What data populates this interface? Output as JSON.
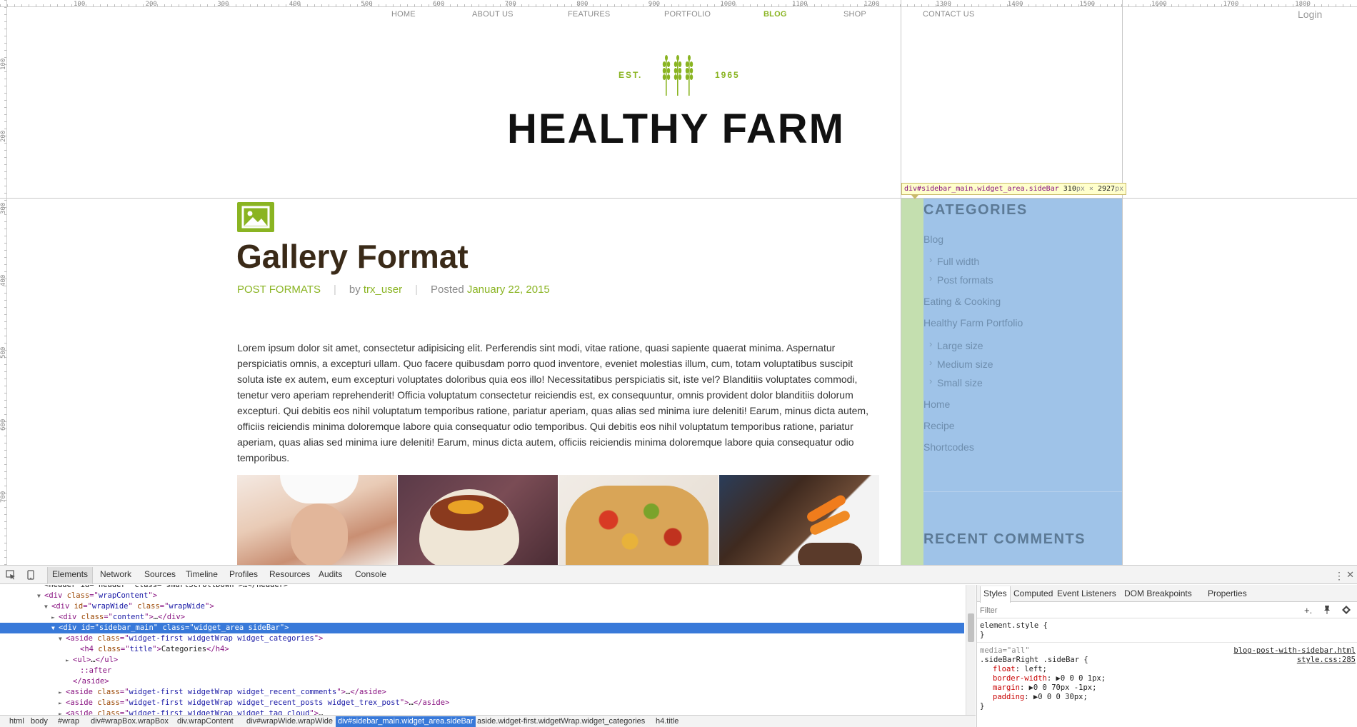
{
  "ruler": {
    "top_ticks": [
      "100",
      "200",
      "300",
      "400",
      "500",
      "600",
      "700",
      "800",
      "900",
      "1000",
      "1100",
      "1200",
      "1300",
      "1400",
      "1500",
      "1600",
      "1700",
      "1800"
    ],
    "left_ticks": [
      "100",
      "200",
      "300",
      "400",
      "500",
      "600",
      "700"
    ]
  },
  "nav": {
    "items": [
      "HOME",
      "ABOUT US",
      "FEATURES",
      "PORTFOLIO",
      "BLOG",
      "SHOP",
      "CONTACT US"
    ],
    "active": "BLOG",
    "login": "Login"
  },
  "logo": {
    "est": "EST.",
    "year": "1965",
    "site_title": "HEALTHY FARM"
  },
  "post": {
    "title": "Gallery Format",
    "category": "POST FORMATS",
    "by_label": "by",
    "author": "trx_user",
    "posted_label": "Posted",
    "date": "January 22, 2015",
    "body": "Lorem ipsum dolor sit amet, consectetur adipisicing elit. Perferendis sint modi, vitae ratione, quasi sapiente quaerat minima. Aspernatur perspiciatis omnis, a excepturi ullam. Quo facere quibusdam porro quod inventore, eveniet molestias illum, cum, totam voluptatibus suscipit soluta iste ex autem, eum excepturi voluptates doloribus quia eos illo! Necessitatibus perspiciatis sit, iste vel? Blanditiis voluptates commodi, tenetur vero aperiam reprehenderit! Officia voluptatum consectetur reiciendis est, ex consequuntur, omnis provident dolor blanditiis dolorum excepturi. Qui debitis eos nihil voluptatum temporibus ratione, pariatur aperiam, quas alias sed minima iure deleniti! Earum, minus dicta autem, officiis reiciendis minima doloremque labore quia consequatur odio temporibus. Qui debitis eos nihil voluptatum temporibus ratione, pariatur aperiam, quas alias sed minima iure deleniti! Earum, minus dicta autem, officiis reiciendis minima doloremque labore quia consequatur odio temporibus."
  },
  "inspector_tooltip": {
    "selector": "div#sidebar_main.widget_area.sideBar",
    "width": "310",
    "height": "2927",
    "unit": "px",
    "times": "×"
  },
  "sidebar": {
    "categories_title": "CATEGORIES",
    "categories": [
      {
        "label": "Blog",
        "sub": false
      },
      {
        "label": "Full width",
        "sub": true
      },
      {
        "label": "Post formats",
        "sub": true
      },
      {
        "label": "Eating & Cooking",
        "sub": false
      },
      {
        "label": "Healthy Farm Portfolio",
        "sub": false
      },
      {
        "label": "Large size",
        "sub": true
      },
      {
        "label": "Medium size",
        "sub": true
      },
      {
        "label": "Small size",
        "sub": true
      },
      {
        "label": "Home",
        "sub": false
      },
      {
        "label": "Recipe",
        "sub": false
      },
      {
        "label": "Shortcodes",
        "sub": false
      }
    ],
    "recent_comments_title": "RECENT COMMENTS"
  },
  "devtools": {
    "tabs": [
      "Elements",
      "Network",
      "Sources",
      "Timeline",
      "Profiles",
      "Resources",
      "Audits",
      "Console"
    ],
    "active_tab": "Elements",
    "tree": [
      {
        "indent": 5,
        "tri": "",
        "html": [
          [
            "t-txt",
            "<header id=\"header\" class=\"smartScrollDown\">…</header>"
          ]
        ]
      },
      {
        "indent": 5,
        "tri": "▼",
        "html": [
          [
            "t-tag",
            "<div "
          ],
          [
            "t-attr",
            "class"
          ],
          [
            "t-tag",
            "=\""
          ],
          [
            "t-val",
            "wrapContent"
          ],
          [
            "t-tag",
            "\">"
          ]
        ]
      },
      {
        "indent": 6,
        "tri": "▼",
        "html": [
          [
            "t-tag",
            "<div "
          ],
          [
            "t-attr",
            "id"
          ],
          [
            "t-tag",
            "=\""
          ],
          [
            "t-val",
            "wrapWide"
          ],
          [
            "t-tag",
            "\" "
          ],
          [
            "t-attr",
            "class"
          ],
          [
            "t-tag",
            "=\""
          ],
          [
            "t-val",
            "wrapWide"
          ],
          [
            "t-tag",
            "\">"
          ]
        ]
      },
      {
        "indent": 7,
        "tri": "►",
        "html": [
          [
            "t-tag",
            "<div "
          ],
          [
            "t-attr",
            "class"
          ],
          [
            "t-tag",
            "=\""
          ],
          [
            "t-val",
            "content"
          ],
          [
            "t-tag",
            "\">"
          ],
          [
            "t-txt",
            "…"
          ],
          [
            "t-tag",
            "</div>"
          ]
        ]
      },
      {
        "indent": 7,
        "tri": "▼",
        "selected": true,
        "html": [
          [
            "t-tag",
            "<div "
          ],
          [
            "t-attr",
            "id"
          ],
          [
            "t-tag",
            "=\""
          ],
          [
            "t-val",
            "sidebar_main"
          ],
          [
            "t-tag",
            "\" "
          ],
          [
            "t-attr",
            "class"
          ],
          [
            "t-tag",
            "=\""
          ],
          [
            "t-val",
            "widget_area sideBar"
          ],
          [
            "t-tag",
            "\">"
          ]
        ]
      },
      {
        "indent": 8,
        "tri": "▼",
        "html": [
          [
            "t-tag",
            "<aside "
          ],
          [
            "t-attr",
            "class"
          ],
          [
            "t-tag",
            "=\""
          ],
          [
            "t-val",
            "widget-first widgetWrap widget_categories"
          ],
          [
            "t-tag",
            "\">"
          ]
        ]
      },
      {
        "indent": 10,
        "tri": "",
        "html": [
          [
            "t-tag",
            "<h4 "
          ],
          [
            "t-attr",
            "class"
          ],
          [
            "t-tag",
            "=\""
          ],
          [
            "t-val",
            "title"
          ],
          [
            "t-tag",
            "\">"
          ],
          [
            "t-txt",
            "Categories"
          ],
          [
            "t-tag",
            "</h4>"
          ]
        ]
      },
      {
        "indent": 9,
        "tri": "►",
        "html": [
          [
            "t-tag",
            "<ul>"
          ],
          [
            "t-txt",
            "…"
          ],
          [
            "t-tag",
            "</ul>"
          ]
        ]
      },
      {
        "indent": 10,
        "tri": "",
        "html": [
          [
            "t-tag",
            "::after"
          ]
        ]
      },
      {
        "indent": 9,
        "tri": "",
        "html": [
          [
            "t-tag",
            "</aside>"
          ]
        ]
      },
      {
        "indent": 8,
        "tri": "►",
        "html": [
          [
            "t-tag",
            "<aside "
          ],
          [
            "t-attr",
            "class"
          ],
          [
            "t-tag",
            "=\""
          ],
          [
            "t-val",
            "widget-first widgetWrap widget_recent_comments"
          ],
          [
            "t-tag",
            "\">"
          ],
          [
            "t-txt",
            "…"
          ],
          [
            "t-tag",
            "</aside>"
          ]
        ]
      },
      {
        "indent": 8,
        "tri": "►",
        "html": [
          [
            "t-tag",
            "<aside "
          ],
          [
            "t-attr",
            "class"
          ],
          [
            "t-tag",
            "=\""
          ],
          [
            "t-val",
            "widget-first widgetWrap widget_recent_posts widget_trex_post"
          ],
          [
            "t-tag",
            "\">"
          ],
          [
            "t-txt",
            "…"
          ],
          [
            "t-tag",
            "</aside>"
          ]
        ]
      },
      {
        "indent": 8,
        "tri": "►",
        "html": [
          [
            "t-tag",
            "<aside "
          ],
          [
            "t-attr",
            "class"
          ],
          [
            "t-tag",
            "=\""
          ],
          [
            "t-val",
            "widget-first widgetWrap widget_tag_cloud"
          ],
          [
            "t-tag",
            "\">"
          ],
          [
            "t-txt",
            "…"
          ]
        ]
      }
    ],
    "breadcrumbs": [
      "html",
      "body",
      "#wrap",
      "div#wrapBox.wrapBox",
      "div.wrapContent",
      "div#wrapWide.wrapWide",
      "div#sidebar_main.widget_area.sideBar",
      "aside.widget-first.widgetWrap.widget_categories",
      "h4.title"
    ],
    "active_breadcrumb": "div#sidebar_main.widget_area.sideBar",
    "styles_tabs": [
      "Styles",
      "Computed",
      "Event Listeners",
      "DOM Breakpoints",
      "Properties"
    ],
    "active_styles_tab": "Styles",
    "filter_placeholder": "Filter",
    "element_style_open": "element.style {",
    "element_style_close": "}",
    "media_label": "media=\"all\"",
    "source_file": "blog-post-with-sidebar.html",
    "source_css": "style.css:285",
    "rule_selector": ".sideBarRight .sideBar {",
    "rule_props": [
      {
        "name": "float",
        "value": "left;"
      },
      {
        "name": "border-width",
        "value": "▶0 0 0 1px;"
      },
      {
        "name": "margin",
        "value": "▶0 0 70px -1px;"
      },
      {
        "name": "padding",
        "value": "▶0 0 0 30px;"
      }
    ],
    "rule_close": "}"
  },
  "colors": {
    "brand_green": "#8ab422",
    "highlight_blue": "#9fc3e8",
    "padding_green": "#c4dfaf",
    "selection_blue": "#3879d9"
  }
}
